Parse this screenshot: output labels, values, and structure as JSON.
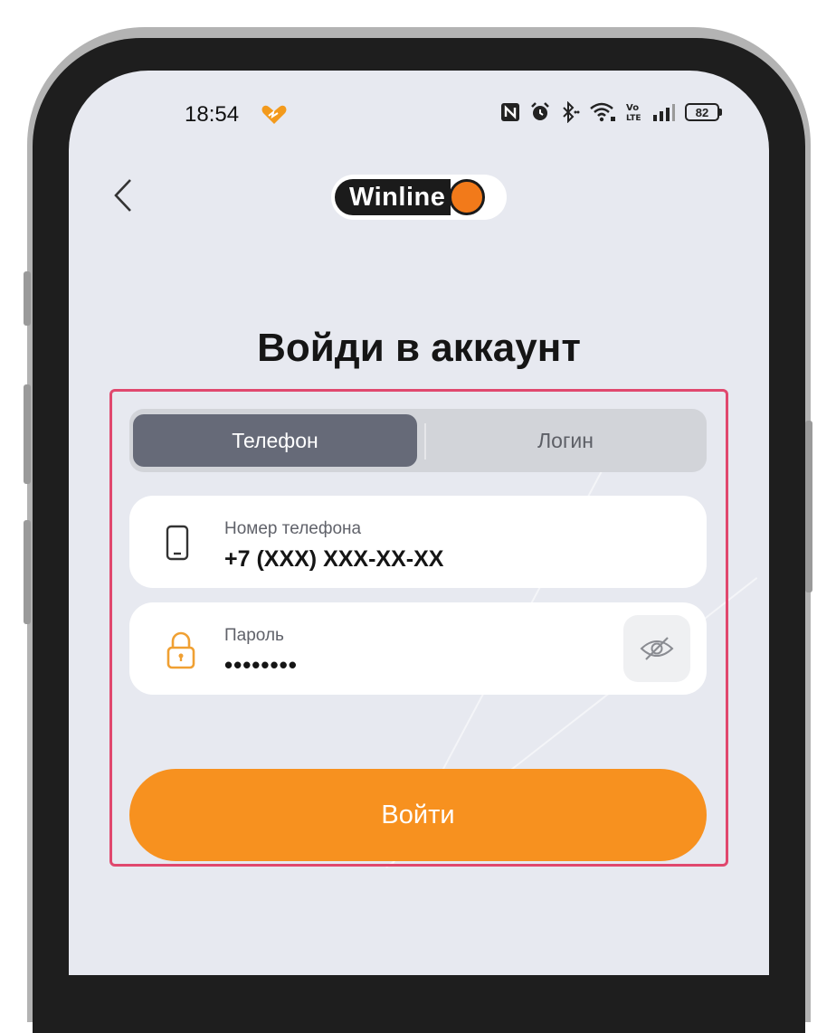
{
  "status_bar": {
    "time": "18:54",
    "battery": "82",
    "icons": [
      "heart-icon",
      "nfc-icon",
      "alarm-icon",
      "bluetooth-icon",
      "wifi-icon",
      "volte-icon",
      "signal-icon",
      "battery-icon"
    ]
  },
  "header": {
    "back_icon": "chevron-left-icon",
    "logo_text": "Winline"
  },
  "page": {
    "title": "Войди в аккаунт"
  },
  "tabs": [
    {
      "label": "Телефон",
      "active": true
    },
    {
      "label": "Логин",
      "active": false
    }
  ],
  "form": {
    "phone": {
      "icon": "smartphone-icon",
      "label": "Номер телефона",
      "value": "+7 (XXX) XXX-XX-XX"
    },
    "password": {
      "icon": "lock-icon",
      "label": "Пароль",
      "value": "••••••••",
      "toggle_icon": "eye-off-icon"
    },
    "submit_label": "Войти"
  },
  "colors": {
    "accent": "#f7911f",
    "lock_icon": "#f0a032",
    "tab_active": "#666a78",
    "highlight": "#e0486e",
    "screen_bg": "#e7e9f0"
  }
}
